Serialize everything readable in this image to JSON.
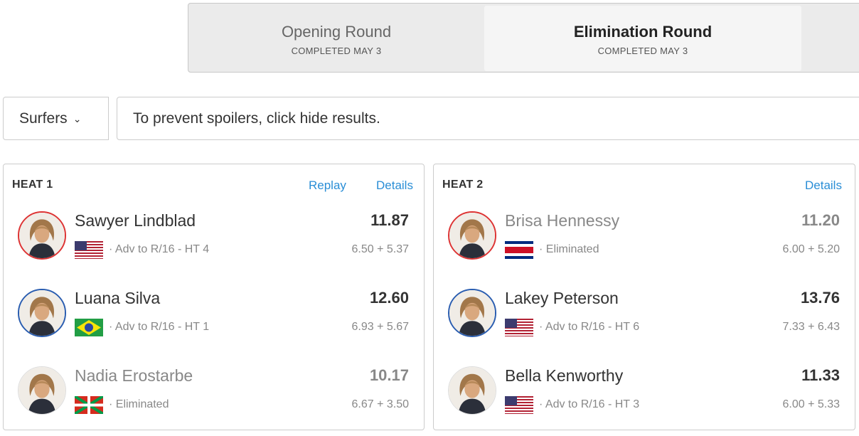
{
  "rounds": [
    {
      "title": "Opening Round",
      "status": "COMPLETED MAY 3"
    },
    {
      "title": "Elimination Round",
      "status": "COMPLETED MAY 3"
    }
  ],
  "filter": {
    "surfers_label": "Surfers",
    "spoiler_text": "To prevent spoilers, click hide results."
  },
  "heats": [
    {
      "title": "HEAT 1",
      "replay_label": "Replay",
      "details_label": "Details",
      "surfers": [
        {
          "name": "Sawyer Lindblad",
          "total": "11.87",
          "flag": "usa-flag-icon",
          "status": "· Adv to R/16 - HT 4",
          "waves": "6.50 + 5.37"
        },
        {
          "name": "Luana Silva",
          "total": "12.60",
          "flag": "brazil-flag-icon",
          "status": "· Adv to R/16 - HT 1",
          "waves": "6.93 + 5.67"
        },
        {
          "name": "Nadia Erostarbe",
          "total": "10.17",
          "flag": "basque-flag-icon",
          "status": "· Eliminated",
          "waves": "6.67 + 3.50"
        }
      ]
    },
    {
      "title": "HEAT 2",
      "details_label": "Details",
      "surfers": [
        {
          "name": "Brisa Hennessy",
          "total": "11.20",
          "flag": "costa-rica-flag-icon",
          "status": "· Eliminated",
          "waves": "6.00 + 5.20"
        },
        {
          "name": "Lakey Peterson",
          "total": "13.76",
          "flag": "usa-flag-icon",
          "status": "· Adv to R/16 - HT 6",
          "waves": "7.33 + 6.43"
        },
        {
          "name": "Bella Kenworthy",
          "total": "11.33",
          "flag": "usa-flag-icon",
          "status": "· Adv to R/16 - HT 3",
          "waves": "6.00 + 5.33"
        }
      ]
    }
  ],
  "colors": {
    "link": "#2a8ed6",
    "eliminated_text": "#888888",
    "avatar_ring_red": "#dd3333",
    "avatar_ring_blue": "#2a5db0"
  }
}
